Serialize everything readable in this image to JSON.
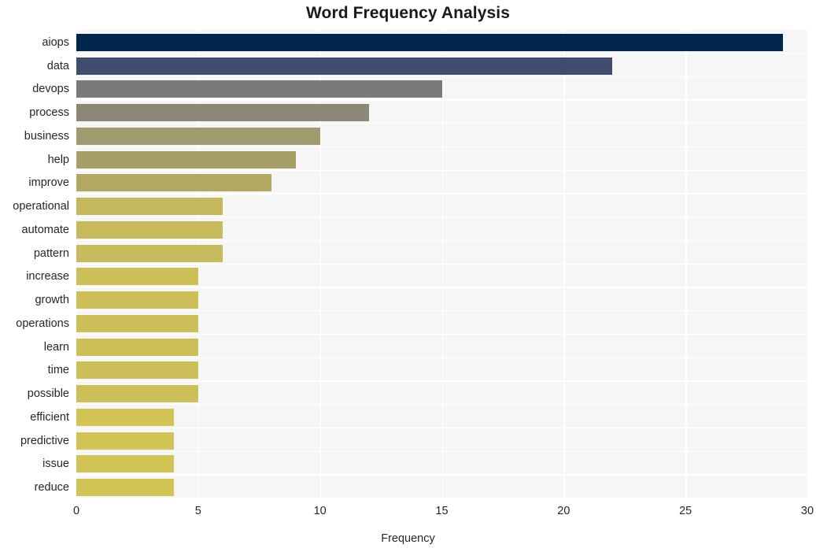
{
  "chart_data": {
    "type": "bar",
    "orientation": "horizontal",
    "title": "Word Frequency Analysis",
    "xlabel": "Frequency",
    "ylabel": "",
    "xlim": [
      0,
      30
    ],
    "xticks": [
      0,
      5,
      10,
      15,
      20,
      25,
      30
    ],
    "grid": true,
    "legend": false,
    "background": "#f6f6f6",
    "gridline_color": "#ffffff",
    "categories": [
      "aiops",
      "data",
      "devops",
      "process",
      "business",
      "help",
      "improve",
      "operational",
      "automate",
      "pattern",
      "increase",
      "growth",
      "operations",
      "learn",
      "time",
      "possible",
      "efficient",
      "predictive",
      "issue",
      "reduce"
    ],
    "values": [
      29,
      22,
      15,
      12,
      10,
      9,
      8,
      6,
      6,
      6,
      5,
      5,
      5,
      5,
      5,
      5,
      4,
      4,
      4,
      4
    ],
    "bar_colors": [
      "#00254f",
      "#414d6e",
      "#7a7a7a",
      "#8d8875",
      "#a19a6f",
      "#a79f68",
      "#b2a862",
      "#c5b85c",
      "#c7ba5b",
      "#c8bb5b",
      "#cdbf58",
      "#cdbf58",
      "#cdbf58",
      "#cdbf58",
      "#cdbf58",
      "#cdbf58",
      "#d3c456",
      "#d3c456",
      "#d3c456",
      "#d3c456"
    ]
  }
}
